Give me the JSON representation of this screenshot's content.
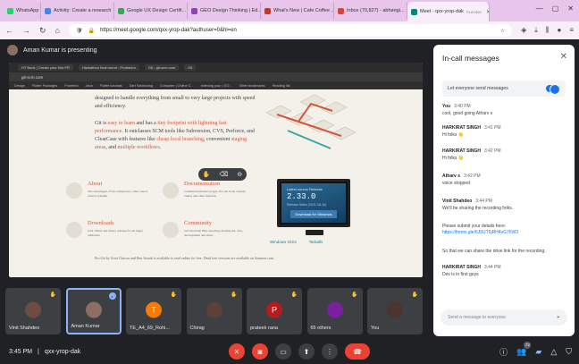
{
  "browser": {
    "tabs": [
      {
        "label": "WhatsApp",
        "color": "#25d366"
      },
      {
        "label": "Activity: Create a research",
        "color": "#4285f4"
      },
      {
        "label": "Google UX Design Certifi...",
        "color": "#34a853"
      },
      {
        "label": "GEO Design Thinking | Ed...",
        "color": "#8e44ad"
      },
      {
        "label": "What's New | Cafe Coffee ...",
        "color": "#c0392b"
      },
      {
        "label": "Inbox (70,827) - abhangi...",
        "color": "#db4437"
      },
      {
        "label": "Meet - qxx-yrop-dak",
        "color": "#00897b"
      }
    ],
    "active_tab_sub": "PLAYING",
    "url": "https://meet.google.com/qxx-yrop-dak?authuser=0&hl=en"
  },
  "presenter": {
    "text": "Aman Kumar is presenting"
  },
  "shared": {
    "tabs": [
      "HT Book | Create your first PR",
      "Hackathon final round - Protractor",
      "Git - git-scm.com",
      "Git"
    ],
    "address": "git-scm.com",
    "bookmarks": [
      "Design",
      "Flutter Packages",
      "Frontend",
      "Java",
      "Flutter tutorials",
      "Dart Sanboxing",
      "Computer | Online C...",
      "Indexing your | GO...",
      "Other bookmarks",
      "Reading list"
    ],
    "para1": "designed to handle everything from small to very large projects with speed and efficiency.",
    "para2_a": "Git is ",
    "para2_b": "easy to learn",
    "para2_c": " and has a ",
    "para2_d": "tiny footprint with lightning fast performance",
    "para2_e": ". It outclasses SCM tools like Subversion, CVS, Perforce, and ClearCase with features like ",
    "para2_f": "cheap local branching",
    "para2_g": ", convenient ",
    "para2_h": "staging areas",
    "para2_i": ", and ",
    "para2_j": "multiple workflows",
    "para2_k": ".",
    "features": [
      {
        "title": "About",
        "desc": "The advantages of Git compared to other source control systems."
      },
      {
        "title": "Documentation",
        "desc": "Command reference pages, Pro Git book content, videos and other material."
      },
      {
        "title": "Downloads",
        "desc": "GUI clients and binary releases for all major platforms."
      },
      {
        "title": "Community",
        "desc": "Get involved! Bug reporting, mailing list, chat, development and more."
      }
    ],
    "release": {
      "title": "Latest source Release",
      "version": "2.33.0",
      "date": "Release Notes (2021-08-16)",
      "button": "Download for Windows"
    },
    "gui_links": [
      "Windows GUIs",
      "Tarballs"
    ],
    "footer": "Pro Git by Scott Chacon and Ben Straub is available to read online for free. Dead tree versions are available on Amazon.com."
  },
  "tiles": [
    {
      "name": "Vinit Shahdeo",
      "initial": "",
      "color": "#6d4c41",
      "speaking": false
    },
    {
      "name": "Aman Kumar",
      "initial": "",
      "color": "#8d6e63",
      "speaking": true
    },
    {
      "name": "TE_A4_69_Rohi...",
      "initial": "T",
      "color": "#f57c00",
      "speaking": false
    },
    {
      "name": "Chirag",
      "initial": "",
      "color": "#5d4037",
      "speaking": false
    },
    {
      "name": "prateek rana",
      "initial": "P",
      "color": "#b71c1c",
      "speaking": false
    },
    {
      "name": "65 others",
      "initial": "",
      "color": "#7b1fa2",
      "speaking": false
    },
    {
      "name": "You",
      "initial": "",
      "color": "#4e342e",
      "speaking": false
    }
  ],
  "meeting": {
    "time": "3:45 PM",
    "separator": "|",
    "code": "qxx-yrop-dak",
    "participants_count": "72"
  },
  "chat": {
    "title": "In-call messages",
    "allow_label": "Let everyone send messages",
    "allow_on": true,
    "messages": [
      {
        "who": "You",
        "when": "3:40 PM",
        "text": "cool, good going Atharv s"
      },
      {
        "who": "HARKIRAT SINGH",
        "when": "3:41 PM",
        "text": "Hi folks 👋"
      },
      {
        "who": "HARKIRAT SINGH",
        "when": "3:42 PM",
        "text": "Hi folks 👋"
      },
      {
        "who": "Atharv s",
        "when": "3:42 PM",
        "text": "voice stopped"
      },
      {
        "who": "Vinit Shahdeo",
        "when": "3:44 PM",
        "text": "We'll be sharing the recording folks."
      },
      {
        "who": "",
        "when": "",
        "text": "Please submit your details here: ",
        "link": "https://forms.gle/6J5UT5jRH4vG7hW3"
      },
      {
        "who": "",
        "when": "",
        "text": "So that we can share the drive link for the recording."
      },
      {
        "who": "HARKIRAT SINGH",
        "when": "3:44 PM",
        "text": "Dev is in first guys"
      }
    ],
    "input_placeholder": "Send a message to everyone"
  }
}
